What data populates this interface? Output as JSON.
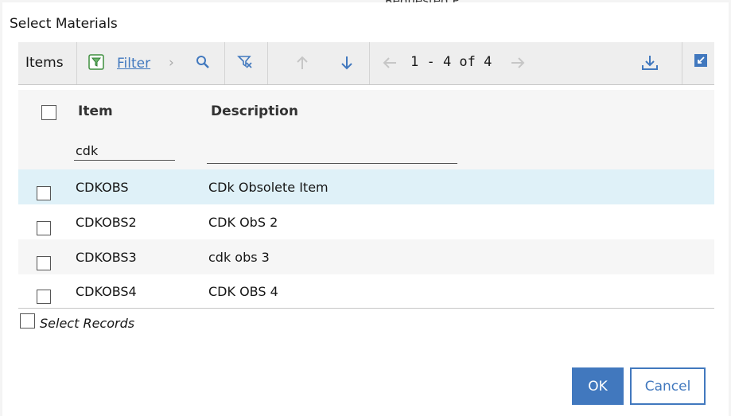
{
  "background": {
    "partial_text": "Requested P"
  },
  "dialog": {
    "title": "Select Materials"
  },
  "toolbar": {
    "items_label": "Items",
    "filter_label": "Filter",
    "pager_text": "1 - 4 of 4",
    "icons": [
      "filter-icon",
      "chevron-right-icon",
      "search-icon",
      "clear-filter-icon",
      "arrow-up-icon",
      "arrow-down-icon",
      "arrow-left-icon",
      "arrow-right-icon",
      "download-icon",
      "collapse-icon"
    ],
    "accent_color": "#4178be"
  },
  "table": {
    "columns": [
      "Item",
      "Description"
    ],
    "filters": {
      "item": "cdk",
      "description": ""
    },
    "rows": [
      {
        "item": "CDKOBS",
        "description": "CDk Obsolete Item",
        "selected": false
      },
      {
        "item": "CDKOBS2",
        "description": "CDK ObS 2",
        "selected": false
      },
      {
        "item": "CDKOBS3",
        "description": "cdk obs 3",
        "selected": false
      },
      {
        "item": "CDKOBS4",
        "description": "CDK OBS 4",
        "selected": false
      }
    ]
  },
  "footer": {
    "select_records_label": "Select Records",
    "ok_label": "OK",
    "cancel_label": "Cancel"
  }
}
